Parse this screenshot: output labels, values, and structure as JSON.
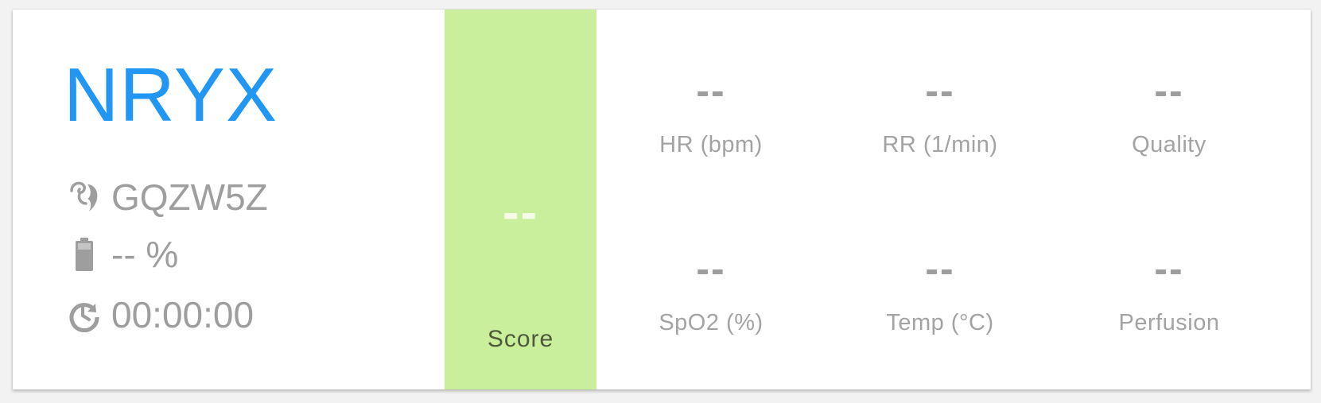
{
  "device": {
    "name": "NRYX",
    "name_color": "#2196f3",
    "sensor_id": "GQZW5Z",
    "sensor_icon": "ear-sensor-icon",
    "battery": "-- %",
    "battery_icon": "battery-icon",
    "elapsed": "00:00:00",
    "elapsed_icon": "restore-clock-icon"
  },
  "score": {
    "value": "--",
    "label": "Score",
    "background_color": "#c9ee9c"
  },
  "metrics": [
    {
      "value": "--",
      "label": "HR (bpm)"
    },
    {
      "value": "--",
      "label": "RR (1/min)"
    },
    {
      "value": "--",
      "label": "Quality"
    },
    {
      "value": "--",
      "label": "SpO2 (%)"
    },
    {
      "value": "--",
      "label": "Temp (°C)"
    },
    {
      "value": "--",
      "label": "Perfusion"
    }
  ]
}
